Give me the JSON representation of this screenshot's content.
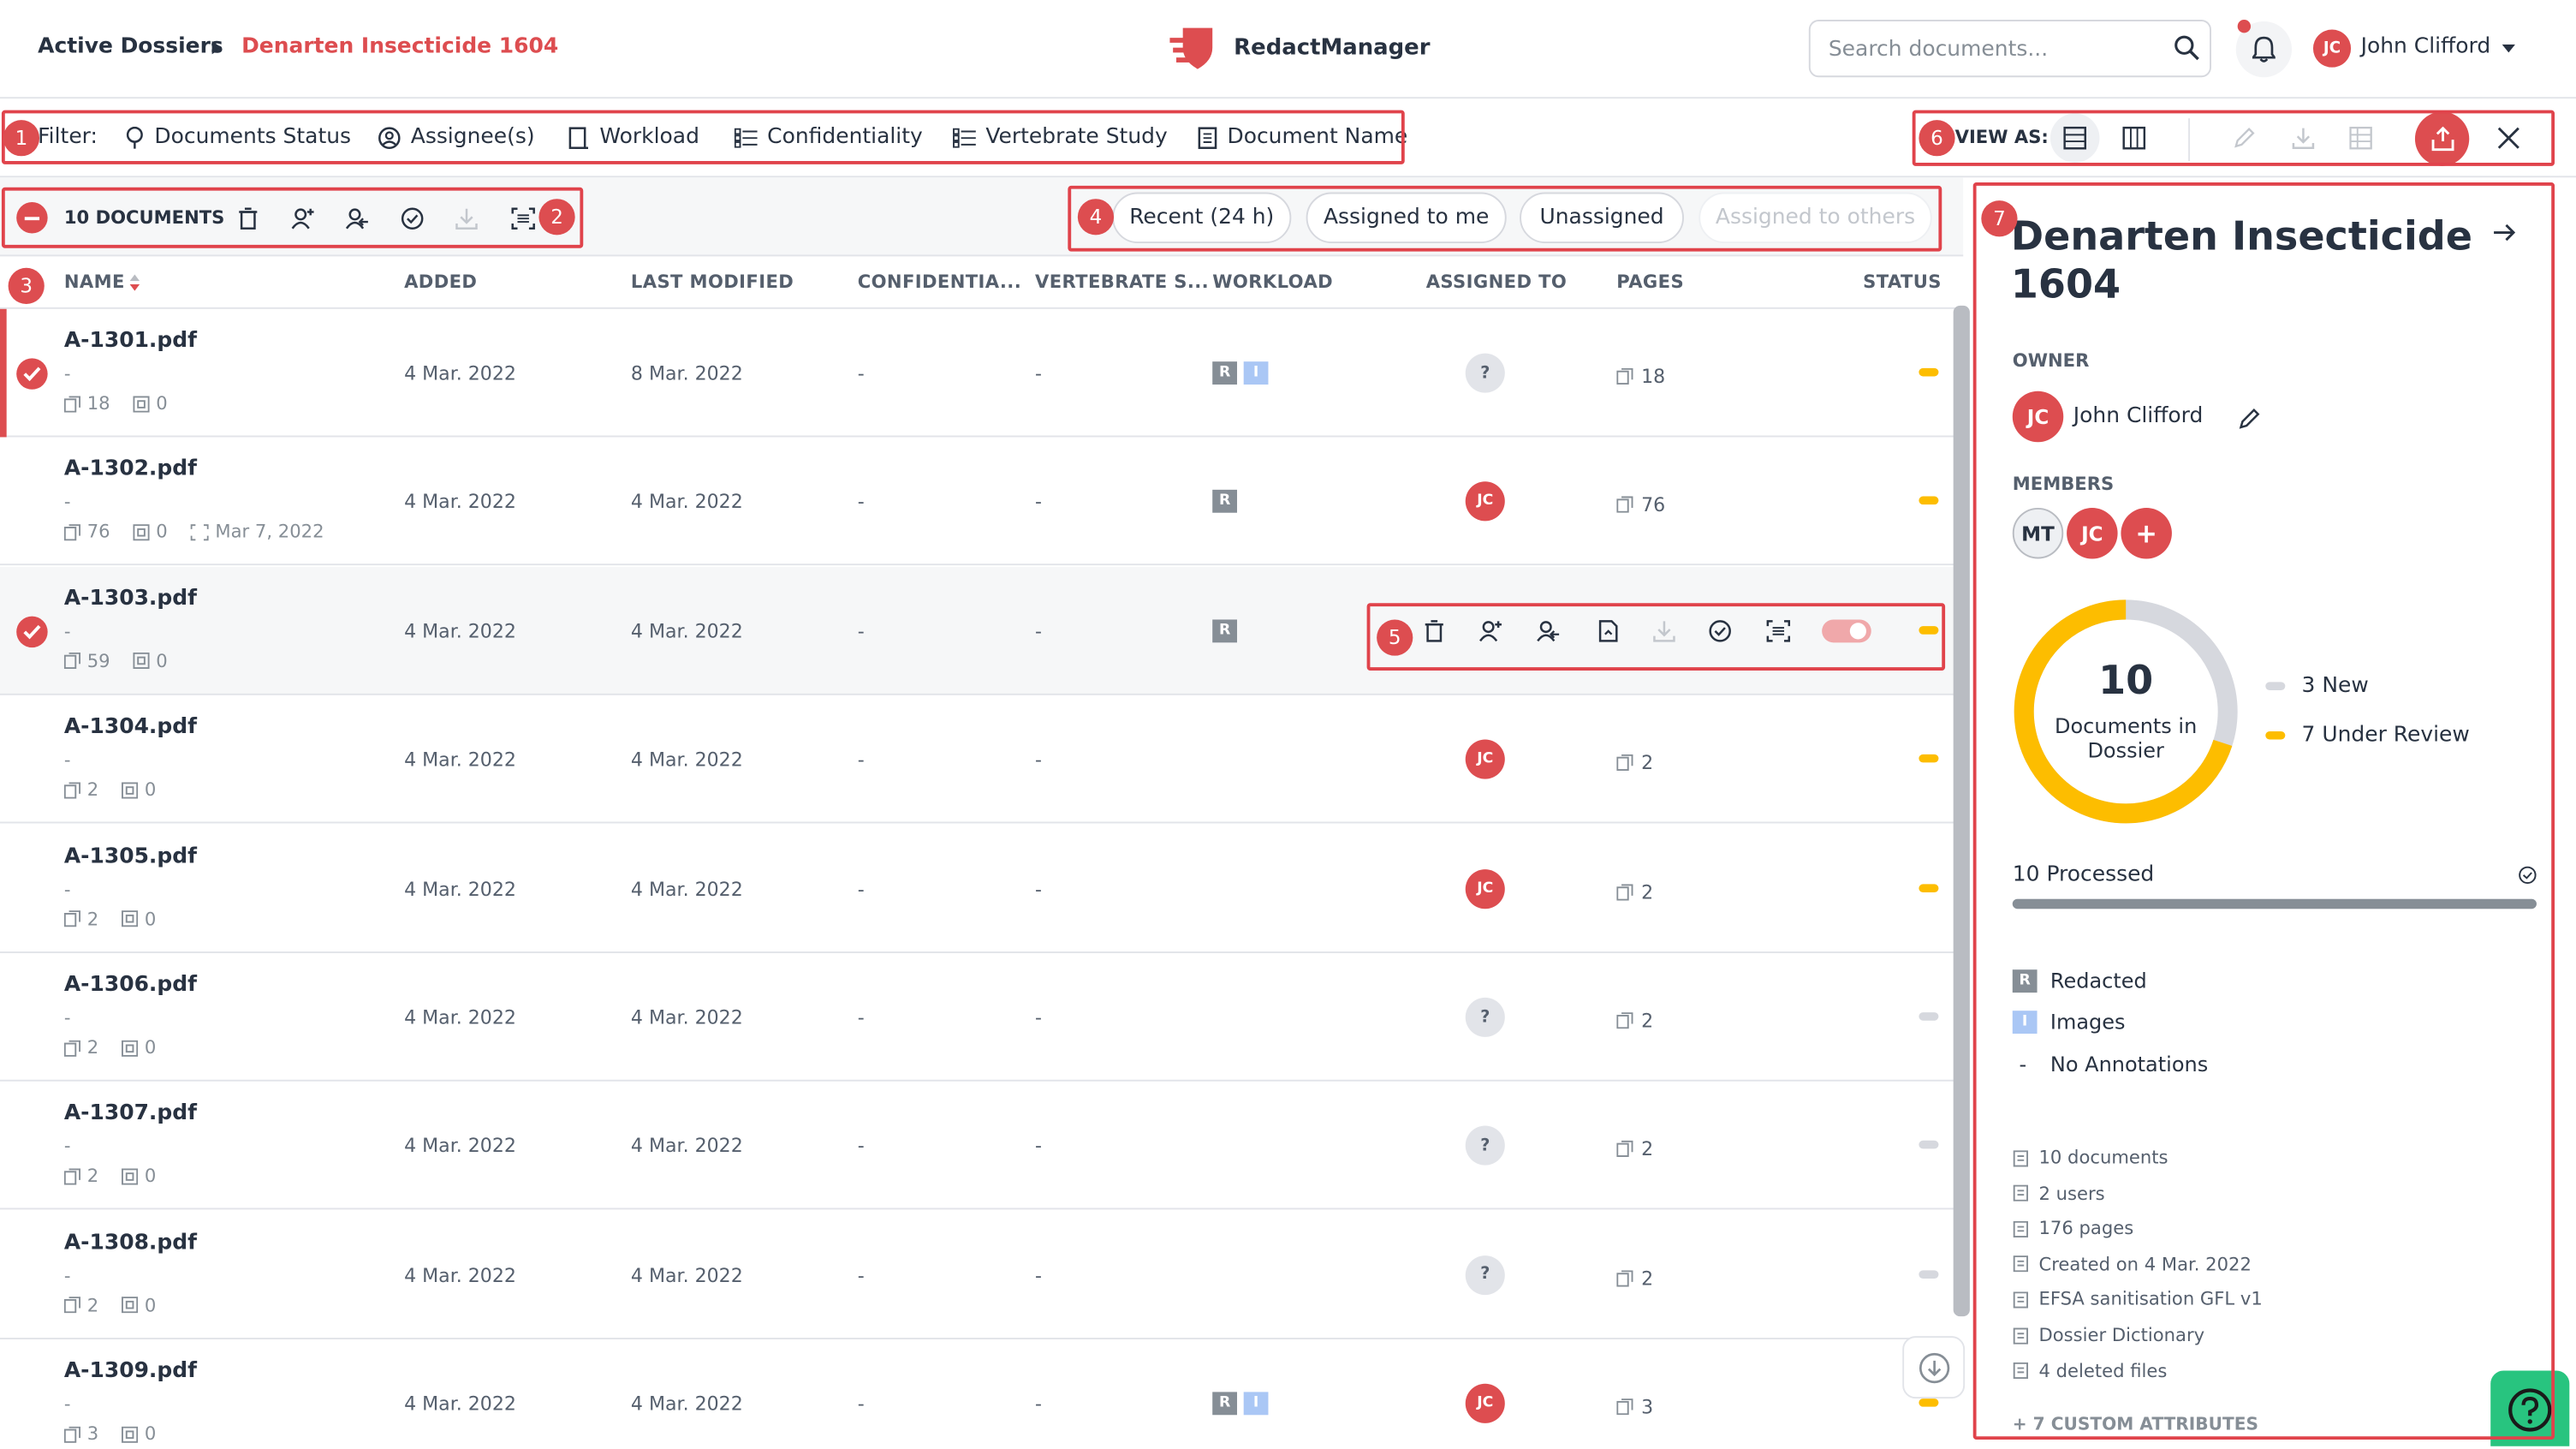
{
  "breadcrumb": {
    "root": "Active Dossiers",
    "current": "Denarten Insecticide 1604"
  },
  "app": {
    "name": "RedactManager"
  },
  "search": {
    "placeholder": "Search documents..."
  },
  "user": {
    "initials": "JC",
    "name": "John Clifford"
  },
  "filter": {
    "label": "Filter:",
    "items": [
      "Documents Status",
      "Assignee(s)",
      "Workload",
      "Confidentiality",
      "Vertebrate Study",
      "Document Name"
    ]
  },
  "view": {
    "label": "VIEW AS:"
  },
  "toolbar": {
    "doc_count": "10 DOCUMENTS"
  },
  "quick_filters": [
    "Recent (24 h)",
    "Assigned to me",
    "Unassigned",
    "Assigned to others"
  ],
  "table": {
    "headers": [
      "NAME",
      "ADDED",
      "LAST MODIFIED",
      "CONFIDENTIA...",
      "VERTEBRATE S...",
      "WORKLOAD",
      "ASSIGNED TO",
      "PAGES",
      "STATUS"
    ],
    "rows": [
      {
        "name": "A-1301.pdf",
        "dash": "-",
        "pages_sub": "18",
        "annot_sub": "0",
        "date_sub": "",
        "added": "4 Mar. 2022",
        "modified": "8 Mar. 2022",
        "conf": "-",
        "vert": "-",
        "wl_r": "R",
        "wl_i": "I",
        "assignee": "?",
        "pages": "18",
        "status_color": "#fdbd00",
        "checked": true
      },
      {
        "name": "A-1302.pdf",
        "dash": "-",
        "pages_sub": "76",
        "annot_sub": "0",
        "date_sub": "Mar 7, 2022",
        "added": "4 Mar. 2022",
        "modified": "4 Mar. 2022",
        "conf": "-",
        "vert": "-",
        "wl_r": "R",
        "wl_i": "",
        "assignee": "JC",
        "pages": "76",
        "status_color": "#fdbd00",
        "checked": false
      },
      {
        "name": "A-1303.pdf",
        "dash": "-",
        "pages_sub": "59",
        "annot_sub": "0",
        "date_sub": "",
        "added": "4 Mar. 2022",
        "modified": "4 Mar. 2022",
        "conf": "-",
        "vert": "-",
        "wl_r": "R",
        "wl_i": "",
        "assignee": "",
        "pages": "",
        "status_color": "#fdbd00",
        "checked": true
      },
      {
        "name": "A-1304.pdf",
        "dash": "-",
        "pages_sub": "2",
        "annot_sub": "0",
        "date_sub": "",
        "added": "4 Mar. 2022",
        "modified": "4 Mar. 2022",
        "conf": "-",
        "vert": "-",
        "wl_r": "",
        "wl_i": "",
        "assignee": "JC",
        "pages": "2",
        "status_color": "#fdbd00",
        "checked": false
      },
      {
        "name": "A-1305.pdf",
        "dash": "-",
        "pages_sub": "2",
        "annot_sub": "0",
        "date_sub": "",
        "added": "4 Mar. 2022",
        "modified": "4 Mar. 2022",
        "conf": "-",
        "vert": "-",
        "wl_r": "",
        "wl_i": "",
        "assignee": "JC",
        "pages": "2",
        "status_color": "#fdbd00",
        "checked": false
      },
      {
        "name": "A-1306.pdf",
        "dash": "-",
        "pages_sub": "2",
        "annot_sub": "0",
        "date_sub": "",
        "added": "4 Mar. 2022",
        "modified": "4 Mar. 2022",
        "conf": "-",
        "vert": "-",
        "wl_r": "",
        "wl_i": "",
        "assignee": "?",
        "pages": "2",
        "status_color": "#d6d8de",
        "checked": false
      },
      {
        "name": "A-1307.pdf",
        "dash": "-",
        "pages_sub": "2",
        "annot_sub": "0",
        "date_sub": "",
        "added": "4 Mar. 2022",
        "modified": "4 Mar. 2022",
        "conf": "-",
        "vert": "-",
        "wl_r": "",
        "wl_i": "",
        "assignee": "?",
        "pages": "2",
        "status_color": "#d6d8de",
        "checked": false
      },
      {
        "name": "A-1308.pdf",
        "dash": "-",
        "pages_sub": "2",
        "annot_sub": "0",
        "date_sub": "",
        "added": "4 Mar. 2022",
        "modified": "4 Mar. 2022",
        "conf": "-",
        "vert": "-",
        "wl_r": "",
        "wl_i": "",
        "assignee": "?",
        "pages": "2",
        "status_color": "#d6d8de",
        "checked": false
      },
      {
        "name": "A-1309.pdf",
        "dash": "-",
        "pages_sub": "3",
        "annot_sub": "0",
        "date_sub": "",
        "added": "4 Mar. 2022",
        "modified": "4 Mar. 2022",
        "conf": "-",
        "vert": "-",
        "wl_r": "R",
        "wl_i": "I",
        "assignee": "JC",
        "pages": "3",
        "status_color": "#fdbd00",
        "checked": false
      }
    ]
  },
  "callouts": [
    "1",
    "2",
    "3",
    "4",
    "5",
    "6",
    "7"
  ],
  "panel": {
    "title": "Denarten Insecticide 1604",
    "owner_label": "OWNER",
    "owner_initials": "JC",
    "owner_name": "John Clifford",
    "members_label": "MEMBERS",
    "members": [
      "MT",
      "JC"
    ],
    "add_member": "+",
    "donut": {
      "total": "10",
      "caption_line1": "Documents in",
      "caption_line2": "Dossier",
      "new_count": 3,
      "review_count": 7
    },
    "legend": [
      {
        "label": "3 New",
        "color": "#d6d8de"
      },
      {
        "label": "7 Under Review",
        "color": "#fdbd00"
      }
    ],
    "processed": {
      "label": "10 Processed",
      "fraction": 1.0
    },
    "workload_legend": [
      {
        "badge": "R",
        "label": "Redacted"
      },
      {
        "badge": "I",
        "label": "Images"
      },
      {
        "badge": "-",
        "label": "No Annotations"
      }
    ],
    "stats": [
      "10 documents",
      "2 users",
      "176 pages",
      "Created on 4 Mar. 2022",
      "EFSA sanitisation GFL v1",
      "Dossier Dictionary",
      "4 deleted files"
    ],
    "custom_attributes": "+ 7 CUSTOM ATTRIBUTES"
  },
  "colors": {
    "accent": "#dd4d50",
    "review": "#fdbd00",
    "new": "#d6d8de",
    "help": "#28c47f"
  }
}
